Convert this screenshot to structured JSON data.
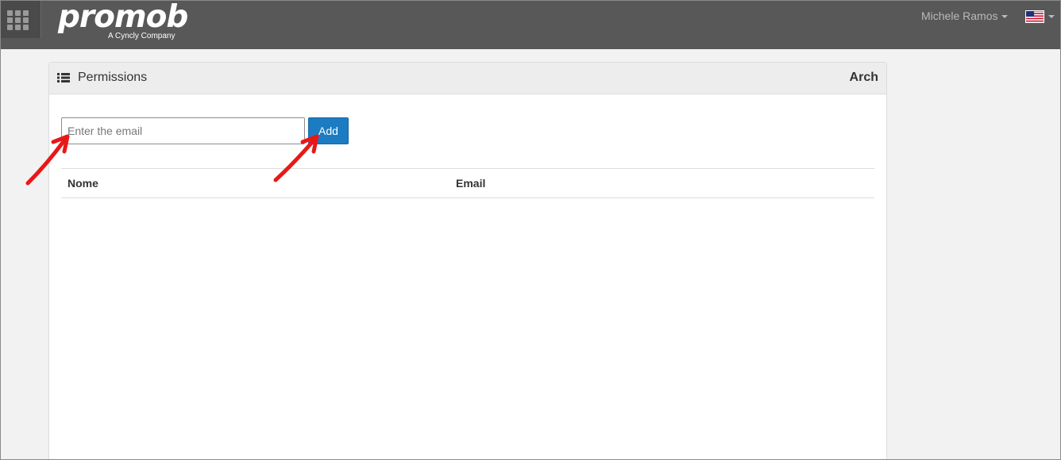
{
  "topbar": {
    "logo_text": "promob",
    "logo_subtext": "A Cyncly Company",
    "user_name": "Michele Ramos",
    "language_flag": "us-flag-icon"
  },
  "panel": {
    "title": "Permissions",
    "right_label": "Arch",
    "email_placeholder": "Enter the email",
    "email_value": "",
    "add_label": "Add"
  },
  "table": {
    "columns": [
      "Nome",
      "Email"
    ],
    "rows": []
  },
  "colors": {
    "topbar": "#585858",
    "accent": "#1c7cc2",
    "annotation": "#e81818"
  }
}
